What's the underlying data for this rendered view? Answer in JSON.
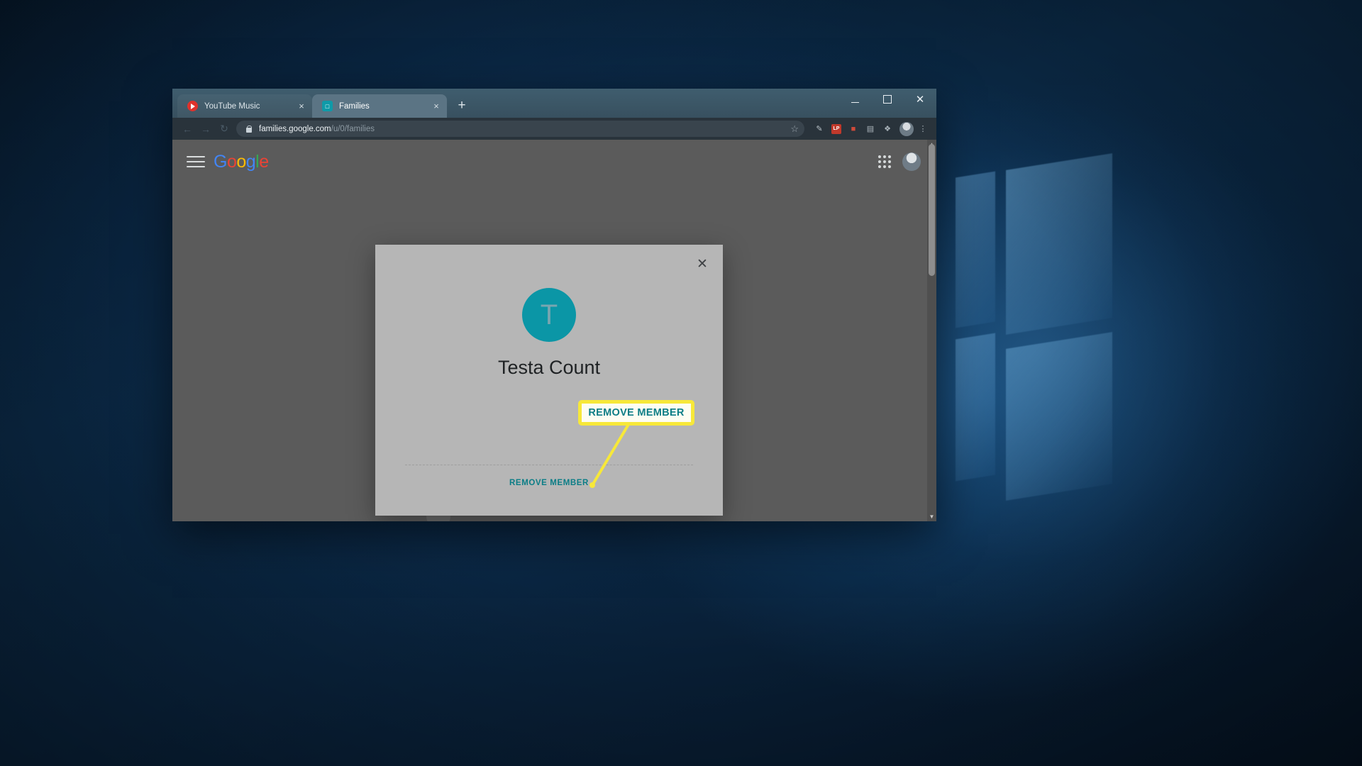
{
  "browser": {
    "tabs": [
      {
        "title": "YouTube Music",
        "favicon": "youtube-music-icon",
        "active": false,
        "close_label": "×"
      },
      {
        "title": "Families",
        "favicon": "families-icon",
        "favicon_glyph": "□",
        "active": true,
        "close_label": "×"
      }
    ],
    "new_tab_label": "+",
    "window_controls": {
      "minimize": "—",
      "maximize": "□",
      "close": "✕"
    },
    "nav": {
      "back": "←",
      "forward": "→",
      "reload": "↻"
    },
    "omnibox": {
      "lock_icon": "lock-icon",
      "url_host": "families.google.com",
      "url_path": "/u/0/families",
      "star_icon": "☆"
    },
    "extensions": [
      {
        "name": "pen-extension-icon",
        "glyph": "✎"
      },
      {
        "name": "badge-extension-icon",
        "glyph": "LP"
      },
      {
        "name": "red-extension-icon",
        "glyph": "■"
      },
      {
        "name": "archive-extension-icon",
        "glyph": "▤"
      },
      {
        "name": "puzzle-extension-icon",
        "glyph": "❖"
      },
      {
        "name": "menu-icon",
        "glyph": "⋮"
      }
    ],
    "profile_avatar": "profile-avatar"
  },
  "page": {
    "header": {
      "menu_label": "hamburger-menu-icon",
      "logo": {
        "g1": "G",
        "o1": "o",
        "o2": "o",
        "g2": "g",
        "l": "l",
        "e": "e"
      },
      "apps_label": "google-apps-icon",
      "account_label": "account-avatar"
    },
    "modal": {
      "close_label": "✕",
      "avatar_initial": "T",
      "avatar_color": "#0b96a6",
      "member_name": "Testa Count",
      "remove_member_label": "REMOVE MEMBER",
      "link_color": "#0b7d86"
    }
  },
  "annotation": {
    "callout_label": "REMOVE MEMBER",
    "highlight_color": "#f7e839",
    "text_color": "#0b7d86"
  }
}
